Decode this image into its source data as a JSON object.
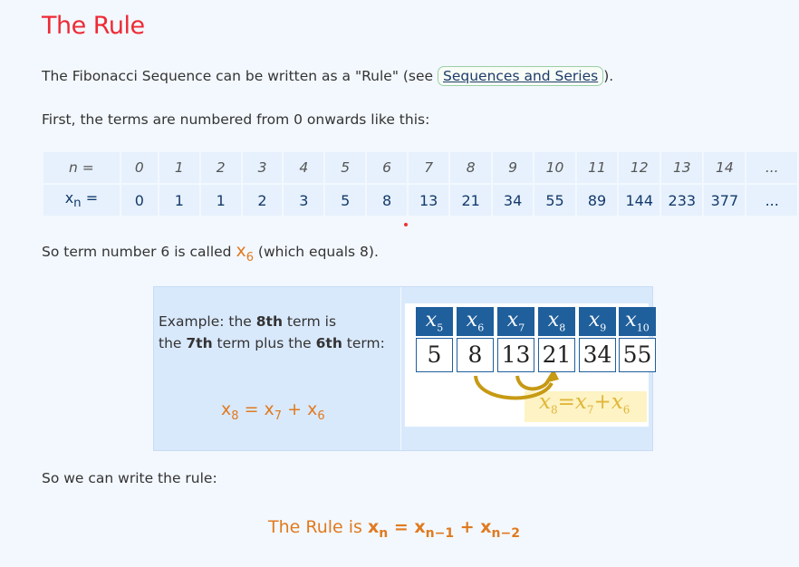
{
  "title": "The Rule",
  "intro": {
    "before": "The Fibonacci Sequence can be written as a \"Rule\" (see ",
    "link": "Sequences and Series",
    "after": ")."
  },
  "numbering_text": "First, the terms are numbered from 0 onwards like this:",
  "table": {
    "n_label": "n =",
    "x_label_base": "x",
    "x_label_sub": "n",
    "x_label_eq": " =",
    "n": [
      "0",
      "1",
      "2",
      "3",
      "4",
      "5",
      "6",
      "7",
      "8",
      "9",
      "10",
      "11",
      "12",
      "13",
      "14",
      "..."
    ],
    "x": [
      "0",
      "1",
      "1",
      "2",
      "3",
      "5",
      "8",
      "13",
      "21",
      "34",
      "55",
      "89",
      "144",
      "233",
      "377",
      "..."
    ]
  },
  "term6": {
    "before": "So term number 6 is called ",
    "x_base": "x",
    "x_sub": "6",
    "after": " (which equals 8)."
  },
  "example": {
    "line1_a": "Example: the ",
    "line1_b": "8th",
    "line1_c": " term is",
    "line2_a": "the ",
    "line2_b": "7th",
    "line2_c": " term plus the ",
    "line2_d": "6th",
    "line2_e": " term:",
    "formula": {
      "a": "x",
      "a_sub": "8",
      "eq": " = ",
      "b": "x",
      "b_sub": "7",
      "plus": " + ",
      "c": "x",
      "c_sub": "6"
    },
    "diagram": {
      "headers": [
        {
          "b": "x",
          "s": "5"
        },
        {
          "b": "x",
          "s": "6"
        },
        {
          "b": "x",
          "s": "7"
        },
        {
          "b": "x",
          "s": "8"
        },
        {
          "b": "x",
          "s": "9"
        },
        {
          "b": "x",
          "s": "10"
        }
      ],
      "values": [
        "5",
        "8",
        "13",
        "21",
        "34",
        "55"
      ],
      "result": {
        "a": "x",
        "a_sub": "8",
        "eq": "=",
        "b": "x",
        "b_sub": "7",
        "plus": "+",
        "c": "x",
        "c_sub": "6"
      },
      "arrow_color": "#c79a14"
    }
  },
  "write_rule": "So we can write the rule:",
  "rule": {
    "prefix": "The Rule is ",
    "a": "x",
    "a_sub": "n",
    "eq": " = ",
    "b": "x",
    "b_sub": "n−1",
    "plus": " + ",
    "c": "x",
    "c_sub": "n−2"
  },
  "colors": {
    "title": "#ee2a35",
    "accent": "#e07a1f",
    "header_blue": "#1f5f9c",
    "table_bg": "#e6f1fd"
  }
}
